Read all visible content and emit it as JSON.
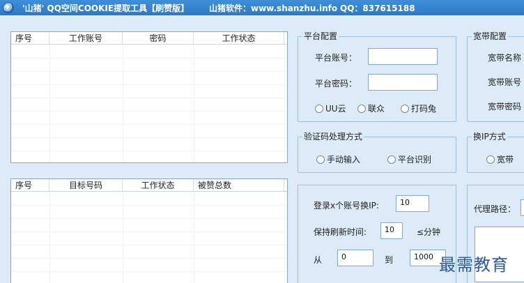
{
  "window": {
    "title": "'山猪' QQ空间COOKIE提取工具【刷赞版】",
    "vendor": "山猪软件：www.shanzhu.info",
    "qq": "QQ：837615188"
  },
  "account_table": {
    "columns": [
      "序号",
      "工作账号",
      "密码",
      "工作状态"
    ]
  },
  "target_table": {
    "columns": [
      "序号",
      "目标号码",
      "工作状态",
      "被赞总数"
    ]
  },
  "platform_config": {
    "title": "平台配置",
    "account_label": "平台账号：",
    "account_value": "",
    "password_label": "平台密码：",
    "password_value": "",
    "options": [
      "UU云",
      "联众",
      "打码兔"
    ]
  },
  "captcha": {
    "title": "验证码处理方式",
    "options": [
      "手动输入",
      "平台识别"
    ]
  },
  "broadband": {
    "title": "宽带配置",
    "name_label": "宽带名称",
    "account_label": "宽带账号",
    "password_label": "宽带密码"
  },
  "ip_switch": {
    "title": "换IP方式",
    "option": "宽带"
  },
  "login_settings": {
    "switch_label": "登录x个账号换IP:",
    "switch_value": "10",
    "refresh_label": "保持刷新时间:",
    "refresh_value": "10",
    "refresh_unit": "≤分钟",
    "from_label": "从",
    "from_value": "0",
    "to_label": "到",
    "to_value": "1000"
  },
  "proxy": {
    "label": "代理路径："
  },
  "watermark": "最需教育"
}
